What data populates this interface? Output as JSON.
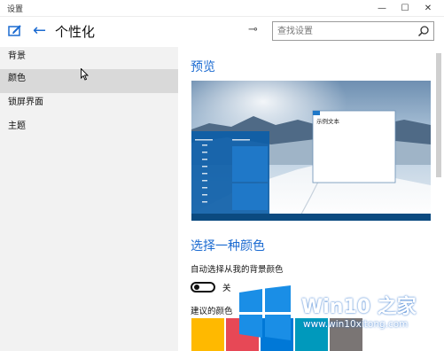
{
  "window": {
    "title": "设置",
    "controls": {
      "minimize": "—",
      "maximize": "☐",
      "close": "✕"
    }
  },
  "header": {
    "back_icon": "←",
    "page_title": "个性化",
    "pin_icon": "⊸",
    "search_placeholder": "查找设置"
  },
  "sidebar": {
    "items": [
      {
        "label": "背景",
        "active": false
      },
      {
        "label": "颜色",
        "active": true
      },
      {
        "label": "锁屏界面",
        "active": false
      },
      {
        "label": "主题",
        "active": false
      }
    ]
  },
  "main": {
    "preview_title": "预览",
    "preview_sample_text": "示例文本",
    "color_section_title": "选择一种颜色",
    "auto_pick_label": "自动选择从我的背景颜色",
    "auto_pick_toggle_state": "关",
    "suggested_colors_label": "建议的颜色",
    "suggested_colors": [
      "#ffb900",
      "#e74856",
      "#0078d7",
      "#0099bc",
      "#7a7574"
    ]
  },
  "watermark": {
    "title": "Win10 之家",
    "url": "www.win10xitong.com"
  },
  "colors": {
    "accent": "#1c6bd1",
    "sidebar_bg": "#f2f2f2",
    "sidebar_active": "#d9d9d9",
    "taskbar": "#0b4a80",
    "start_menu": "#0d5ea8"
  }
}
